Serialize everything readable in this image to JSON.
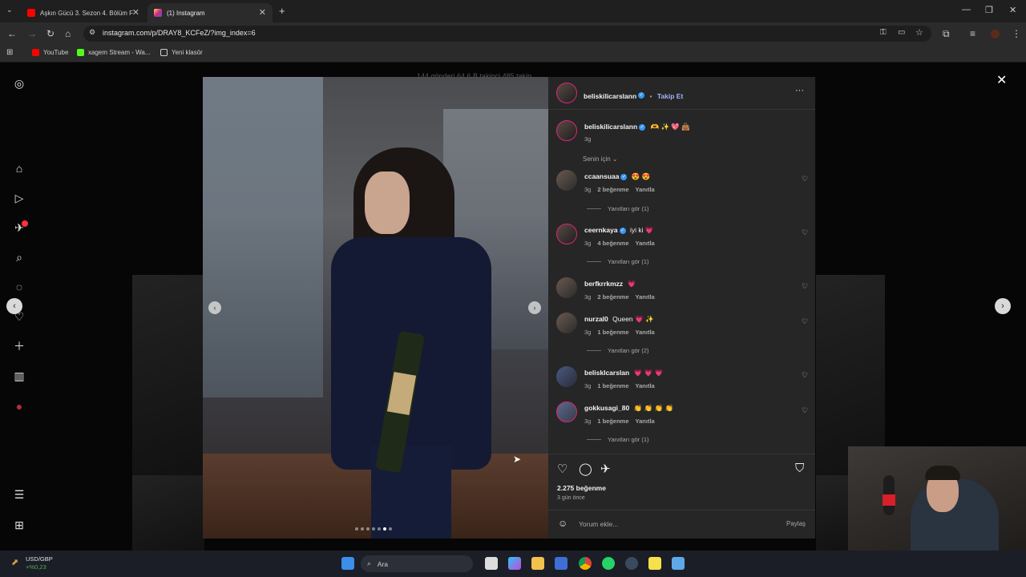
{
  "browser": {
    "tabs": [
      {
        "label": "Aşkın Gücü 3. Sezon 4. Bölüm F",
        "favicon_color": "#ff0000"
      },
      {
        "label": "(1) Instagram",
        "favicon_color": "#d62976"
      }
    ],
    "new_tab_symbol": "+",
    "url": "instagram.com/p/DRAY8_KCFeZ/?img_index=6",
    "bookmarks": [
      {
        "label": "YouTube",
        "icon": "youtube-icon"
      },
      {
        "label": "xagem Stream - Wa...",
        "icon": "kick-icon"
      },
      {
        "label": "Yeni klasör",
        "icon": "folder-icon"
      }
    ]
  },
  "background_profile": {
    "stats": "144 gönderi   64,6 B takipçi   485 takip"
  },
  "post": {
    "author": "beliskilicarslann",
    "follow_label": "Takip Et",
    "caption": "🫶 ✨ 💖 👜",
    "caption_time": "3g",
    "sort_label": "Senin için",
    "comments": [
      {
        "user": "ccaansuaa",
        "verified": true,
        "text": "😍 😍",
        "time": "3g",
        "likes": "2 beğenme",
        "reply": "Yanıtla",
        "replies": "Yanıtları gör (1)"
      },
      {
        "user": "ceernkaya",
        "verified": true,
        "text": "iyi ki 💗",
        "time": "3g",
        "likes": "4 beğenme",
        "reply": "Yanıtla",
        "replies": "Yanıtları gör (1)"
      },
      {
        "user": "berfkrrkmzz",
        "verified": false,
        "text": "💗",
        "time": "3g",
        "likes": "2 beğenme",
        "reply": "Yanıtla",
        "replies": ""
      },
      {
        "user": "nurzal0",
        "verified": false,
        "text": "Queen 💗 ✨",
        "time": "3g",
        "likes": "1 beğenme",
        "reply": "Yanıtla",
        "replies": "Yanıtları gör (2)"
      },
      {
        "user": "beliskIcarslan",
        "verified": false,
        "text": "💗 💗 💗",
        "time": "3g",
        "likes": "1 beğenme",
        "reply": "Yanıtla",
        "replies": ""
      },
      {
        "user": "gokkusagi_80",
        "verified": false,
        "text": "👏 👏 👏 👏",
        "time": "3g",
        "likes": "1 beğenme",
        "reply": "Yanıtla",
        "replies": "Yanıtları gör (1)"
      }
    ],
    "likes_total": "2.275 beğenme",
    "posted_ago": "3 gün önce",
    "comment_placeholder": "Yorum ekle...",
    "share_label": "Paylaş",
    "carousel": {
      "total": 7,
      "current": 6
    }
  },
  "taskbar": {
    "ticker": "USD/GBP",
    "ticker_change": "+%0,23",
    "search_label": "Ara"
  },
  "colors": {
    "accent_blue": "#3897f0",
    "follow_link": "#a5b4fc",
    "panel_bg": "#262626",
    "story_ring": "#d62976"
  }
}
